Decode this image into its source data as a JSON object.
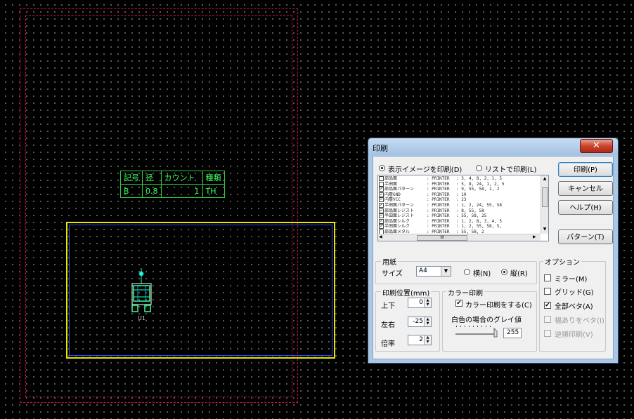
{
  "hole_table": {
    "headers": [
      "記号",
      "径",
      "カウント",
      "種類"
    ],
    "row": [
      "B",
      "0.8",
      "1",
      "TH"
    ]
  },
  "component": {
    "ref": "U1"
  },
  "dialog": {
    "title": "印刷",
    "close_glyph": "✕",
    "radio_display_image": "表示イメージを印刷(D)",
    "radio_list": "リストで印刷(L)",
    "layers": [
      {
        "name": "部品面",
        "dev": ": PRINTER",
        "params": ": 3, 4, 8, 2, 1, 5",
        "checked": false
      },
      {
        "name": "半田面",
        "dev": ": PRINTER",
        "params": ": 5, 8, 24, 1, 2, 5",
        "checked": false
      },
      {
        "name": "部品面パターン",
        "dev": ": PRINTER",
        "params": ": 9, 55, 58, 1, 2",
        "checked": true
      },
      {
        "name": "内層GND",
        "dev": ": PRINTER",
        "params": ": 10",
        "checked": true
      },
      {
        "name": "内層VCC",
        "dev": ": PRINTER",
        "params": ": 23",
        "checked": true
      },
      {
        "name": "半田面パターン",
        "dev": ": PRINTER",
        "params": ": 1, 2, 24, 55, 58",
        "checked": true
      },
      {
        "name": "部品面レジスト",
        "dev": ": PRINTER",
        "params": ": 8, 55, 58",
        "checked": true
      },
      {
        "name": "半田面レジスト",
        "dev": ": PRINTER",
        "params": ": 55, 58, 25",
        "checked": true
      },
      {
        "name": "部品面シルク",
        "dev": ": PRINTER",
        "params": ": 1, 2, 8, 3, 4, 5",
        "checked": true
      },
      {
        "name": "半田面シルク",
        "dev": ": PRINTER",
        "params": ": 1, 2, 55, 58, 5,",
        "checked": true
      },
      {
        "name": "部品面メタル",
        "dev": ": PRINTER",
        "params": ": 55, 58, 2",
        "checked": false
      }
    ],
    "hscroll_thumb": "III",
    "buttons": {
      "print": "印刷(P)",
      "cancel": "キャンセル",
      "help": "ヘルプ(H)",
      "pattern": "パターン(T)"
    },
    "paper": {
      "group_title": "用紙",
      "size_label": "サイズ",
      "size_value": "A4",
      "landscape": "横(N)",
      "portrait": "縦(R)"
    },
    "position": {
      "group_title": "印刷位置(mm)",
      "updown_label": "上下",
      "updown_value": "0",
      "leftright_label": "左右",
      "leftright_value": "-25",
      "scale_label": "倍率",
      "scale_value": "2"
    },
    "color": {
      "group_title": "カラー印刷",
      "checkbox": "カラー印刷をする(C)",
      "gray_label": "白色の場合のグレイ値",
      "gray_value": "255"
    },
    "options": {
      "group_title": "オプション",
      "mirror": "ミラー(M)",
      "grid": "グリッド(G)",
      "all_solid": "全部ベタ(A)",
      "width_solid": "幅ありをベタ(I)",
      "reverse": "逆順印刷(V)"
    }
  }
}
